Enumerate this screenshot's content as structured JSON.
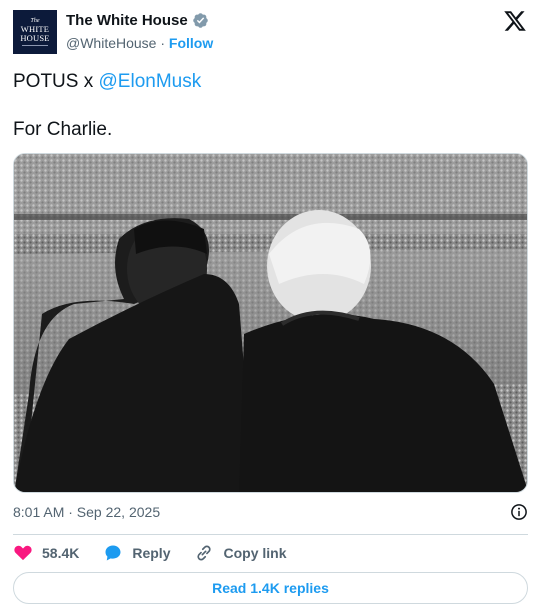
{
  "header": {
    "avatar_lines": [
      "The",
      "WHITE",
      "HOUSE"
    ],
    "name": "The White House",
    "handle": "@WhiteHouse",
    "separator": "·",
    "follow_label": "Follow"
  },
  "post": {
    "line1_prefix": "POTUS x ",
    "mention": "@ElonMusk",
    "line2": "For Charlie.",
    "photo_icon": "photo-two-men-stadium",
    "timestamp": "8:01 AM · Sep 22, 2025"
  },
  "actions": {
    "likes": "58.4K",
    "reply_label": "Reply",
    "copy_link_label": "Copy link",
    "read_replies_label": "Read 1.4K replies"
  },
  "colors": {
    "accent": "#1d9bf0",
    "like": "#f91880",
    "text": "#0f1419",
    "muted": "#536471"
  }
}
